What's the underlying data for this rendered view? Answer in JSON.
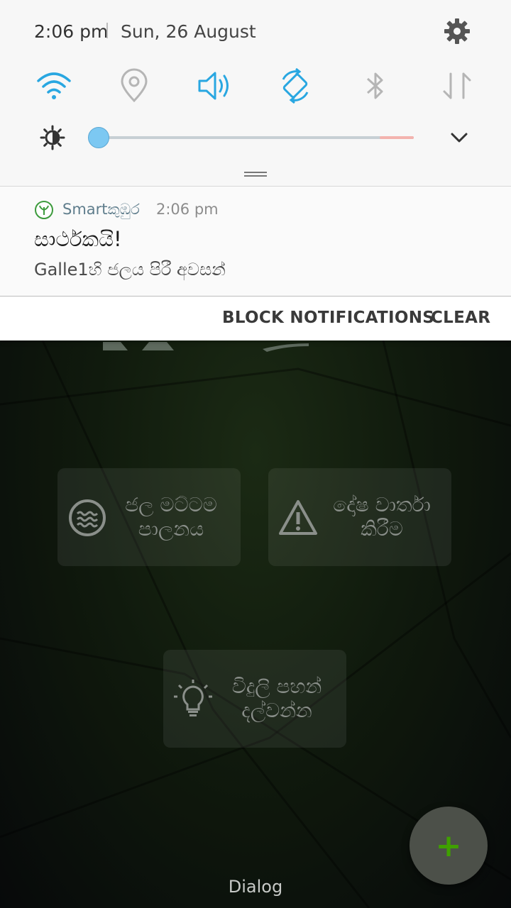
{
  "status_bar": {
    "time": "2:06 pm",
    "date": "Sun, 26 August"
  },
  "quick_settings": {
    "icons": [
      "wifi-icon",
      "location-icon",
      "sound-icon",
      "auto-rotate-icon",
      "bluetooth-icon",
      "mobile-data-icon"
    ],
    "active_color": "#29a7e1",
    "inactive_color": "#b5b5b5"
  },
  "brightness": {
    "level": 0.03
  },
  "notification": {
    "app_name": "Smartකුඹුර",
    "time": "2:06 pm",
    "title": "සාර්ථකයි!",
    "body": "Galle1හි ජලය පිරී අවසන්",
    "actions": {
      "block": "BLOCK NOTIFICATIONS",
      "clear": "CLEAR"
    }
  },
  "app": {
    "tiles": [
      {
        "label": "ජල මට්ටම\nපාලනය",
        "icon": "water-icon"
      },
      {
        "label": "දෝෂ වාර්තා\nකිරීම",
        "icon": "warning-icon"
      },
      {
        "label": "විදුලි පහන්\nදල්වන්න",
        "icon": "lightbulb-icon"
      }
    ],
    "fab_label": "+",
    "fab_color": "#3fa000",
    "bottom_label": "Dialog"
  }
}
